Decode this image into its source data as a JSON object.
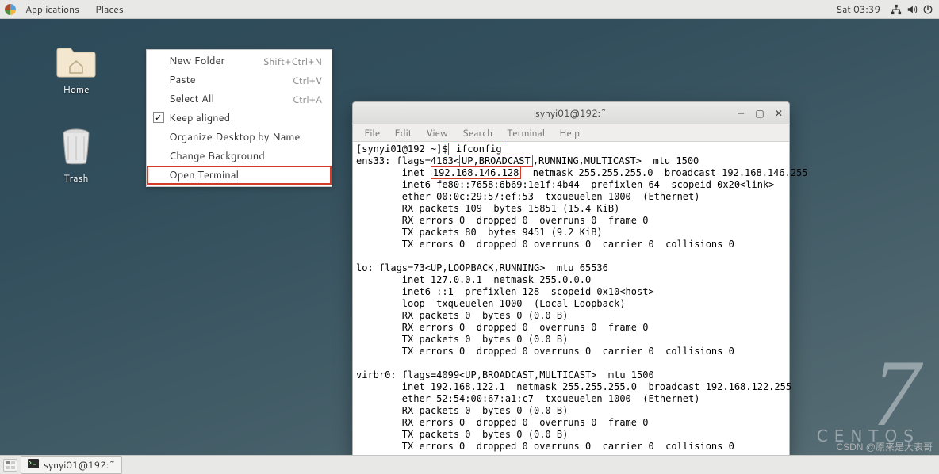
{
  "panel": {
    "apps": "Applications",
    "places": "Places",
    "clock": "Sat 03:39"
  },
  "desktop": {
    "home": "Home",
    "trash": "Trash"
  },
  "context_menu": {
    "items": [
      {
        "label": "New Folder",
        "accel": "Shift+Ctrl+N"
      },
      {
        "label": "Paste",
        "accel": "Ctrl+V"
      },
      {
        "label": "Select All",
        "accel": "Ctrl+A"
      },
      {
        "label": "Keep aligned",
        "check": true
      },
      {
        "label": "Organize Desktop by Name"
      },
      {
        "label": "Change Background"
      },
      {
        "label": "Open Terminal",
        "highlighted": true
      }
    ]
  },
  "terminal": {
    "title": "synyi01@192:~",
    "menubar": [
      "File",
      "Edit",
      "View",
      "Search",
      "Terminal",
      "Help"
    ],
    "prompt_prefix": "[synyi01@192 ~]$",
    "command": " ifconfig",
    "ip_highlight": "192.168.146.128",
    "seg_a": "ens33: flags=4163<",
    "seg_b": "UP,BROADCAST",
    "seg_c": ",RUNNING,MULTICAST>  mtu 1500",
    "seg_d": "        inet ",
    "seg_e": "  netmask 255.255.255.0  broadcast 192.168.146.255",
    "lines_after": [
      "        inet6 fe80::7658:6b69:1e1f:4b44  prefixlen 64  scopeid 0x20<link>",
      "        ether 00:0c:29:57:ef:53  txqueuelen 1000  (Ethernet)",
      "        RX packets 109  bytes 15851 (15.4 KiB)",
      "        RX errors 0  dropped 0  overruns 0  frame 0",
      "        TX packets 80  bytes 9451 (9.2 KiB)",
      "        TX errors 0  dropped 0 overruns 0  carrier 0  collisions 0",
      "",
      "lo: flags=73<UP,LOOPBACK,RUNNING>  mtu 65536",
      "        inet 127.0.0.1  netmask 255.0.0.0",
      "        inet6 ::1  prefixlen 128  scopeid 0x10<host>",
      "        loop  txqueuelen 1000  (Local Loopback)",
      "        RX packets 0  bytes 0 (0.0 B)",
      "        RX errors 0  dropped 0  overruns 0  frame 0",
      "        TX packets 0  bytes 0 (0.0 B)",
      "        TX errors 0  dropped 0 overruns 0  carrier 0  collisions 0",
      "",
      "virbr0: flags=4099<UP,BROADCAST,MULTICAST>  mtu 1500",
      "        inet 192.168.122.1  netmask 255.255.255.0  broadcast 192.168.122.255",
      "        ether 52:54:00:67:a1:c7  txqueuelen 1000  (Ethernet)",
      "        RX packets 0  bytes 0 (0.0 B)",
      "        RX errors 0  dropped 0  overruns 0  frame 0",
      "        TX packets 0  bytes 0 (0.0 B)",
      "        TX errors 0  dropped 0 overruns 0  carrier 0  collisions 0"
    ]
  },
  "watermark": {
    "digit": "7",
    "word": "CENTOS"
  },
  "taskbar": {
    "task_label": "synyi01@192:~"
  },
  "csdn": "CSDN @原来是大表哥"
}
